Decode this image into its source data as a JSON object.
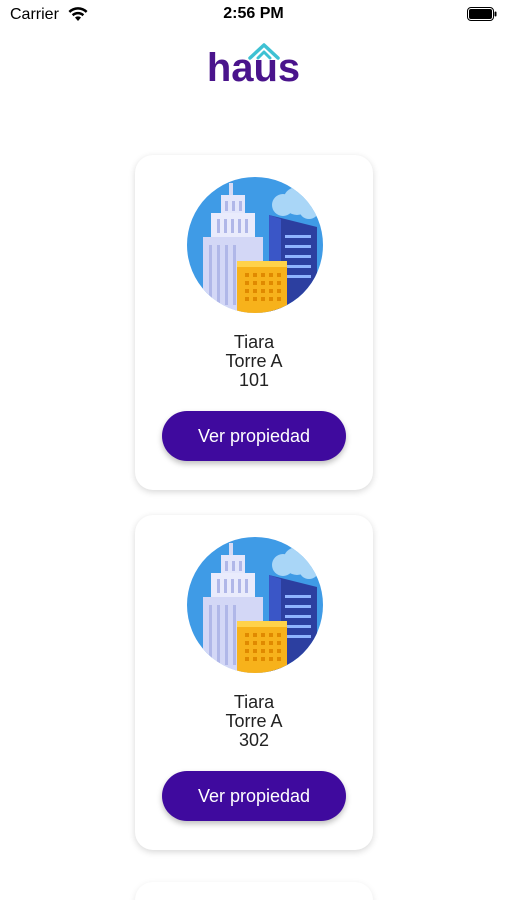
{
  "status_bar": {
    "carrier": "Carrier",
    "time": "2:56 PM",
    "wifi_icon": "wifi-icon",
    "battery_icon": "battery-icon"
  },
  "brand": {
    "logo_text": "haus",
    "color": "#4a148c",
    "roof_color": "#3ec1d3"
  },
  "properties": [
    {
      "name": "Tiara",
      "tower": "Torre A",
      "unit": "101",
      "button_label": "Ver propiedad"
    },
    {
      "name": "Tiara",
      "tower": "Torre A",
      "unit": "302",
      "button_label": "Ver propiedad"
    }
  ],
  "colors": {
    "button": "#3f0a9e",
    "button_text": "#ffffff"
  }
}
